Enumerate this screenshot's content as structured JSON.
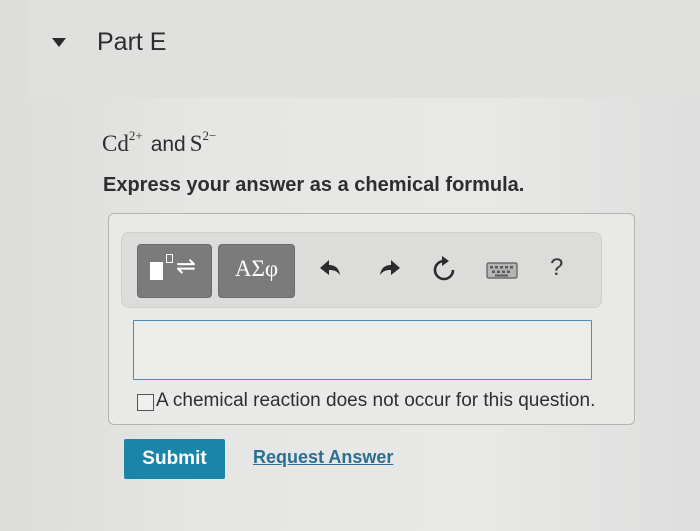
{
  "part": {
    "title": "Part E"
  },
  "question": {
    "ion1_base": "Cd",
    "ion1_charge": "2+",
    "connector": "and",
    "ion2_base": "S",
    "ion2_charge": "2−",
    "instruction": "Express your answer as a chemical formula."
  },
  "toolbar": {
    "greek_label": "ΑΣφ",
    "help_label": "?",
    "tools": [
      "templates-icon",
      "greek-symbols-icon",
      "undo-icon",
      "redo-icon",
      "reset-icon",
      "keyboard-icon",
      "help-icon"
    ]
  },
  "answer": {
    "value": "",
    "no_reaction_label": "A chemical reaction does not occur for this question."
  },
  "actions": {
    "submit_label": "Submit",
    "request_label": "Request Answer"
  },
  "colors": {
    "accent": "#1b84a9",
    "link": "#2b6f92",
    "toolbar_button": "#7b7b7b",
    "input_border": "#4a8fb5"
  }
}
